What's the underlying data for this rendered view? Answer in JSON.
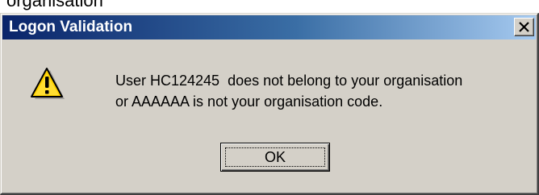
{
  "window": {
    "title": "Logon Validation"
  },
  "above_dialog_fragment": "organisation",
  "message": {
    "line1": "User HC124245  does not belong to your organisation",
    "line2": "or AAAAAA is not your organisation code."
  },
  "buttons": {
    "ok_label": "OK",
    "close_glyph": "X"
  },
  "icons": {
    "warning": "warning-icon",
    "close": "close-icon"
  },
  "colors": {
    "titlebar_start": "#0a246a",
    "titlebar_end": "#a6caf0",
    "dialog_face": "#d4d0c8",
    "warning_fill": "#ffd200"
  }
}
